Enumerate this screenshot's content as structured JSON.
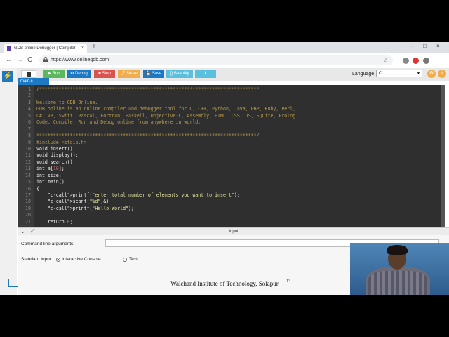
{
  "browser": {
    "tab_title": "GDB online Debugger | Compiler",
    "tab_close": "×",
    "new_tab": "+",
    "url": "https://www.onlinegdb.com",
    "back": "←",
    "forward": "→",
    "reload": "C",
    "star": "☆",
    "minimize": "–",
    "maximize": "□",
    "close": "×"
  },
  "toolbar": {
    "run": "▶ Run",
    "debug": "⚙ Debug",
    "stop": "■ Stop",
    "share": "⤴ Share",
    "save": "💾 Save",
    "beautify": "{} Beautify",
    "download": "⬇",
    "language_label": "Language",
    "language_value": "C",
    "colors": {
      "run": "#5cb85c",
      "debug": "#1e79c4",
      "stop": "#d9534f",
      "share": "#f0ad4e",
      "save": "#1e79c4",
      "beautify": "#5bc0de",
      "download": "#5bc0de"
    }
  },
  "sidebar": {
    "icon": "⚡"
  },
  "file_tab": "main.c",
  "code_lines": [
    {
      "n": "1",
      "t": "/*******************************************************************************"
    },
    {
      "n": "2",
      "t": ""
    },
    {
      "n": "3",
      "t": "Welcome to GDB Online."
    },
    {
      "n": "4",
      "t": "GDB online is an online compiler and debugger tool for C, C++, Python, Java, PHP, Ruby, Perl,"
    },
    {
      "n": "5",
      "t": "C#, VB, Swift, Pascal, Fortran, Haskell, Objective-C, Assembly, HTML, CSS, JS, SQLite, Prolog."
    },
    {
      "n": "6",
      "t": "Code, Compile, Run and Debug online from anywhere in world."
    },
    {
      "n": "7",
      "t": ""
    },
    {
      "n": "8",
      "t": "*******************************************************************************/"
    },
    {
      "n": "9",
      "t": "#include <stdio.h>"
    },
    {
      "n": "10",
      "t": "void insert();"
    },
    {
      "n": "11",
      "t": "void display();"
    },
    {
      "n": "12",
      "t": "void search();"
    },
    {
      "n": "13",
      "t": "int a[10];"
    },
    {
      "n": "14",
      "t": "int size;"
    },
    {
      "n": "15",
      "t": "int main()"
    },
    {
      "n": "16",
      "t": "{"
    },
    {
      "n": "17",
      "t": "    printf(\"enter total number of elements you want to insert\");"
    },
    {
      "n": "18",
      "t": "    scanf(\"%d\",&)"
    },
    {
      "n": "19",
      "t": "    printf(\"Hello World\");"
    },
    {
      "n": "20",
      "t": ""
    },
    {
      "n": "21",
      "t": "    return 0;"
    }
  ],
  "input_panel": {
    "header": "Input",
    "collapse": "⌄",
    "expand": "⤢",
    "cla_label": "Command line arguments:",
    "cla_value": "",
    "stdin_label": "Standard Input:",
    "opt_interactive": "Interactive Console",
    "opt_text": "Text"
  },
  "slide": {
    "caption": "Walchand Institute of Technology, Solapur",
    "number": "13"
  }
}
